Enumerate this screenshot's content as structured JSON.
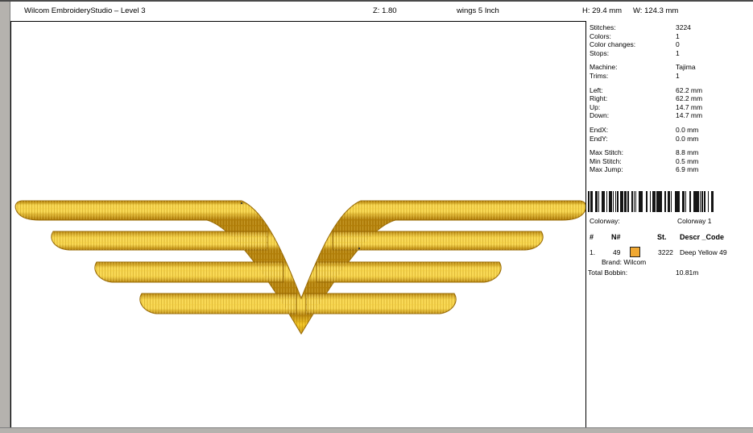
{
  "window": {
    "title": "Wilcom EmbroideryStudio – Level 3"
  },
  "statusbar": {
    "zoom": "Z: 1.80",
    "filename": "wings 5 Inch",
    "hoop_height": "H: 29.4 mm",
    "hoop_width": "W: 124.3 mm"
  },
  "panel": {
    "stats_groups": [
      [
        {
          "label": "Stitches:",
          "value": "3224"
        },
        {
          "label": "Colors:",
          "value": "1"
        },
        {
          "label": "Color changes:",
          "value": "0"
        },
        {
          "label": "Stops:",
          "value": "1"
        }
      ],
      [
        {
          "label": "Machine:",
          "value": "Tajima"
        },
        {
          "label": "Trims:",
          "value": "1"
        }
      ],
      [
        {
          "label": "Left:",
          "value": "62.2 mm"
        },
        {
          "label": "Right:",
          "value": "62.2 mm"
        },
        {
          "label": "Up:",
          "value": "14.7 mm"
        },
        {
          "label": "Down:",
          "value": "14.7 mm"
        }
      ],
      [
        {
          "label": "EndX:",
          "value": "0.0 mm"
        },
        {
          "label": "EndY:",
          "value": "0.0 mm"
        }
      ],
      [
        {
          "label": "Max Stitch:",
          "value": "8.8 mm"
        },
        {
          "label": "Min Stitch:",
          "value": "0.5 mm"
        },
        {
          "label": "Max Jump:",
          "value": "6.9 mm"
        }
      ]
    ],
    "colorway": {
      "label": "Colorway:",
      "value": "Colorway 1"
    },
    "thread_table": {
      "headers": {
        "num": "#",
        "n": "N#",
        "st": "St.",
        "descr": "Descr _Code"
      },
      "row": {
        "num": "1.",
        "n": "49",
        "st": "3222",
        "descr": "Deep Yellow 49"
      },
      "brand": "Brand: Wilcom",
      "total": {
        "label": "Total Bobbin:",
        "value": "10.81m"
      }
    }
  },
  "design": {
    "description": "gold embroidered wings emblem with central V and four feather bars per side",
    "colors": {
      "gold-light": "#f8d64b",
      "gold-base": "#f2c41e",
      "gold-dark": "#b5820a",
      "gold-outline": "#9a6c06",
      "swatch": "#f0a832"
    }
  }
}
